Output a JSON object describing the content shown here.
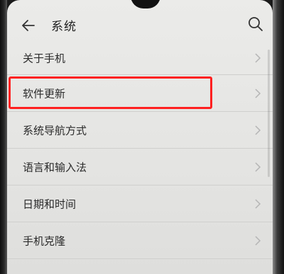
{
  "header": {
    "title": "系统",
    "back_icon": "arrow-left-icon",
    "search_icon": "search-icon"
  },
  "settings": {
    "items": [
      {
        "label": "关于手机"
      },
      {
        "label": "软件更新",
        "highlighted": true
      },
      {
        "label": "系统导航方式"
      },
      {
        "label": "语言和输入法"
      },
      {
        "label": "日期和时间"
      },
      {
        "label": "手机克隆"
      }
    ]
  },
  "colors": {
    "highlight": "#ff2020",
    "background": "#e8e8e6",
    "text": "#2b2b2b"
  }
}
